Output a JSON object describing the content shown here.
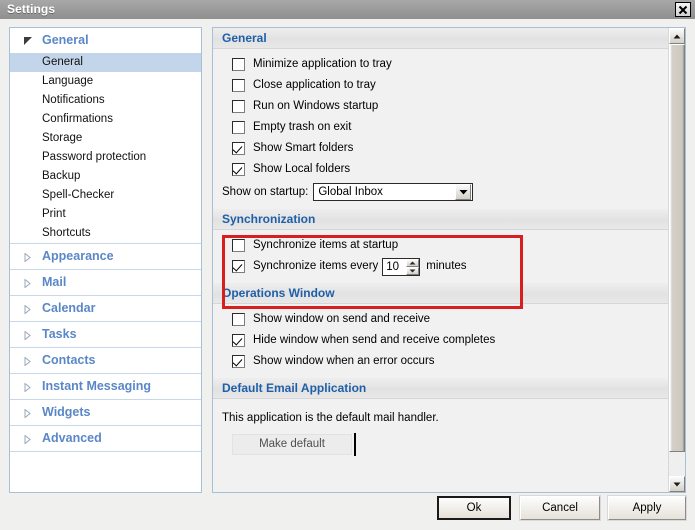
{
  "window": {
    "title": "Settings",
    "close_icon": "close-x-icon"
  },
  "sidebar": {
    "groups": [
      {
        "label": "General",
        "expanded": true,
        "icon": "triangle-down-icon",
        "items": [
          {
            "label": "General",
            "selected": true
          },
          {
            "label": "Language",
            "selected": false
          },
          {
            "label": "Notifications",
            "selected": false
          },
          {
            "label": "Confirmations",
            "selected": false
          },
          {
            "label": "Storage",
            "selected": false
          },
          {
            "label": "Password protection",
            "selected": false
          },
          {
            "label": "Backup",
            "selected": false
          },
          {
            "label": "Spell-Checker",
            "selected": false
          },
          {
            "label": "Print",
            "selected": false
          },
          {
            "label": "Shortcuts",
            "selected": false
          }
        ]
      },
      {
        "label": "Appearance",
        "expanded": false,
        "icon": "triangle-right-icon",
        "items": []
      },
      {
        "label": "Mail",
        "expanded": false,
        "icon": "triangle-right-icon",
        "items": []
      },
      {
        "label": "Calendar",
        "expanded": false,
        "icon": "triangle-right-icon",
        "items": []
      },
      {
        "label": "Tasks",
        "expanded": false,
        "icon": "triangle-right-icon",
        "items": []
      },
      {
        "label": "Contacts",
        "expanded": false,
        "icon": "triangle-right-icon",
        "items": []
      },
      {
        "label": "Instant Messaging",
        "expanded": false,
        "icon": "triangle-right-icon",
        "items": []
      },
      {
        "label": "Widgets",
        "expanded": false,
        "icon": "triangle-right-icon",
        "items": []
      },
      {
        "label": "Advanced",
        "expanded": false,
        "icon": "triangle-right-icon",
        "items": []
      }
    ]
  },
  "main": {
    "sections": {
      "general": {
        "title": "General",
        "checkboxes": [
          {
            "label": "Minimize application to tray",
            "checked": false
          },
          {
            "label": "Close application to tray",
            "checked": false
          },
          {
            "label": "Run on Windows startup",
            "checked": false
          },
          {
            "label": "Empty trash on exit",
            "checked": false
          },
          {
            "label": "Show Smart folders",
            "checked": true
          },
          {
            "label": "Show Local folders",
            "checked": true
          }
        ],
        "startup": {
          "label": "Show on startup:",
          "value": "Global Inbox",
          "arrow_icon": "chevron-down-icon"
        }
      },
      "synchronization": {
        "title": "Synchronization",
        "highlighted": true,
        "highlight_color": "#d81f1f",
        "checkboxes": [
          {
            "label": "Synchronize items at startup",
            "checked": false
          }
        ],
        "interval": {
          "label": "Synchronize items every",
          "checked": true,
          "value": "10",
          "unit": "minutes",
          "up_icon": "spinner-up-icon",
          "down_icon": "spinner-down-icon"
        }
      },
      "operations_window": {
        "title": "Operations Window",
        "checkboxes": [
          {
            "label": "Show window on send and receive",
            "checked": false
          },
          {
            "label": "Hide window when send and receive completes",
            "checked": true
          },
          {
            "label": "Show window when an error occurs",
            "checked": true
          }
        ]
      },
      "default_email": {
        "title": "Default Email Application",
        "status_text": "This application is the default mail handler.",
        "button_label": "Make default"
      }
    },
    "scrollbar": {
      "up_icon": "scroll-up-arrow-icon",
      "down_icon": "scroll-down-arrow-icon"
    }
  },
  "footer": {
    "ok_label": "Ok",
    "cancel_label": "Cancel",
    "apply_label": "Apply"
  }
}
